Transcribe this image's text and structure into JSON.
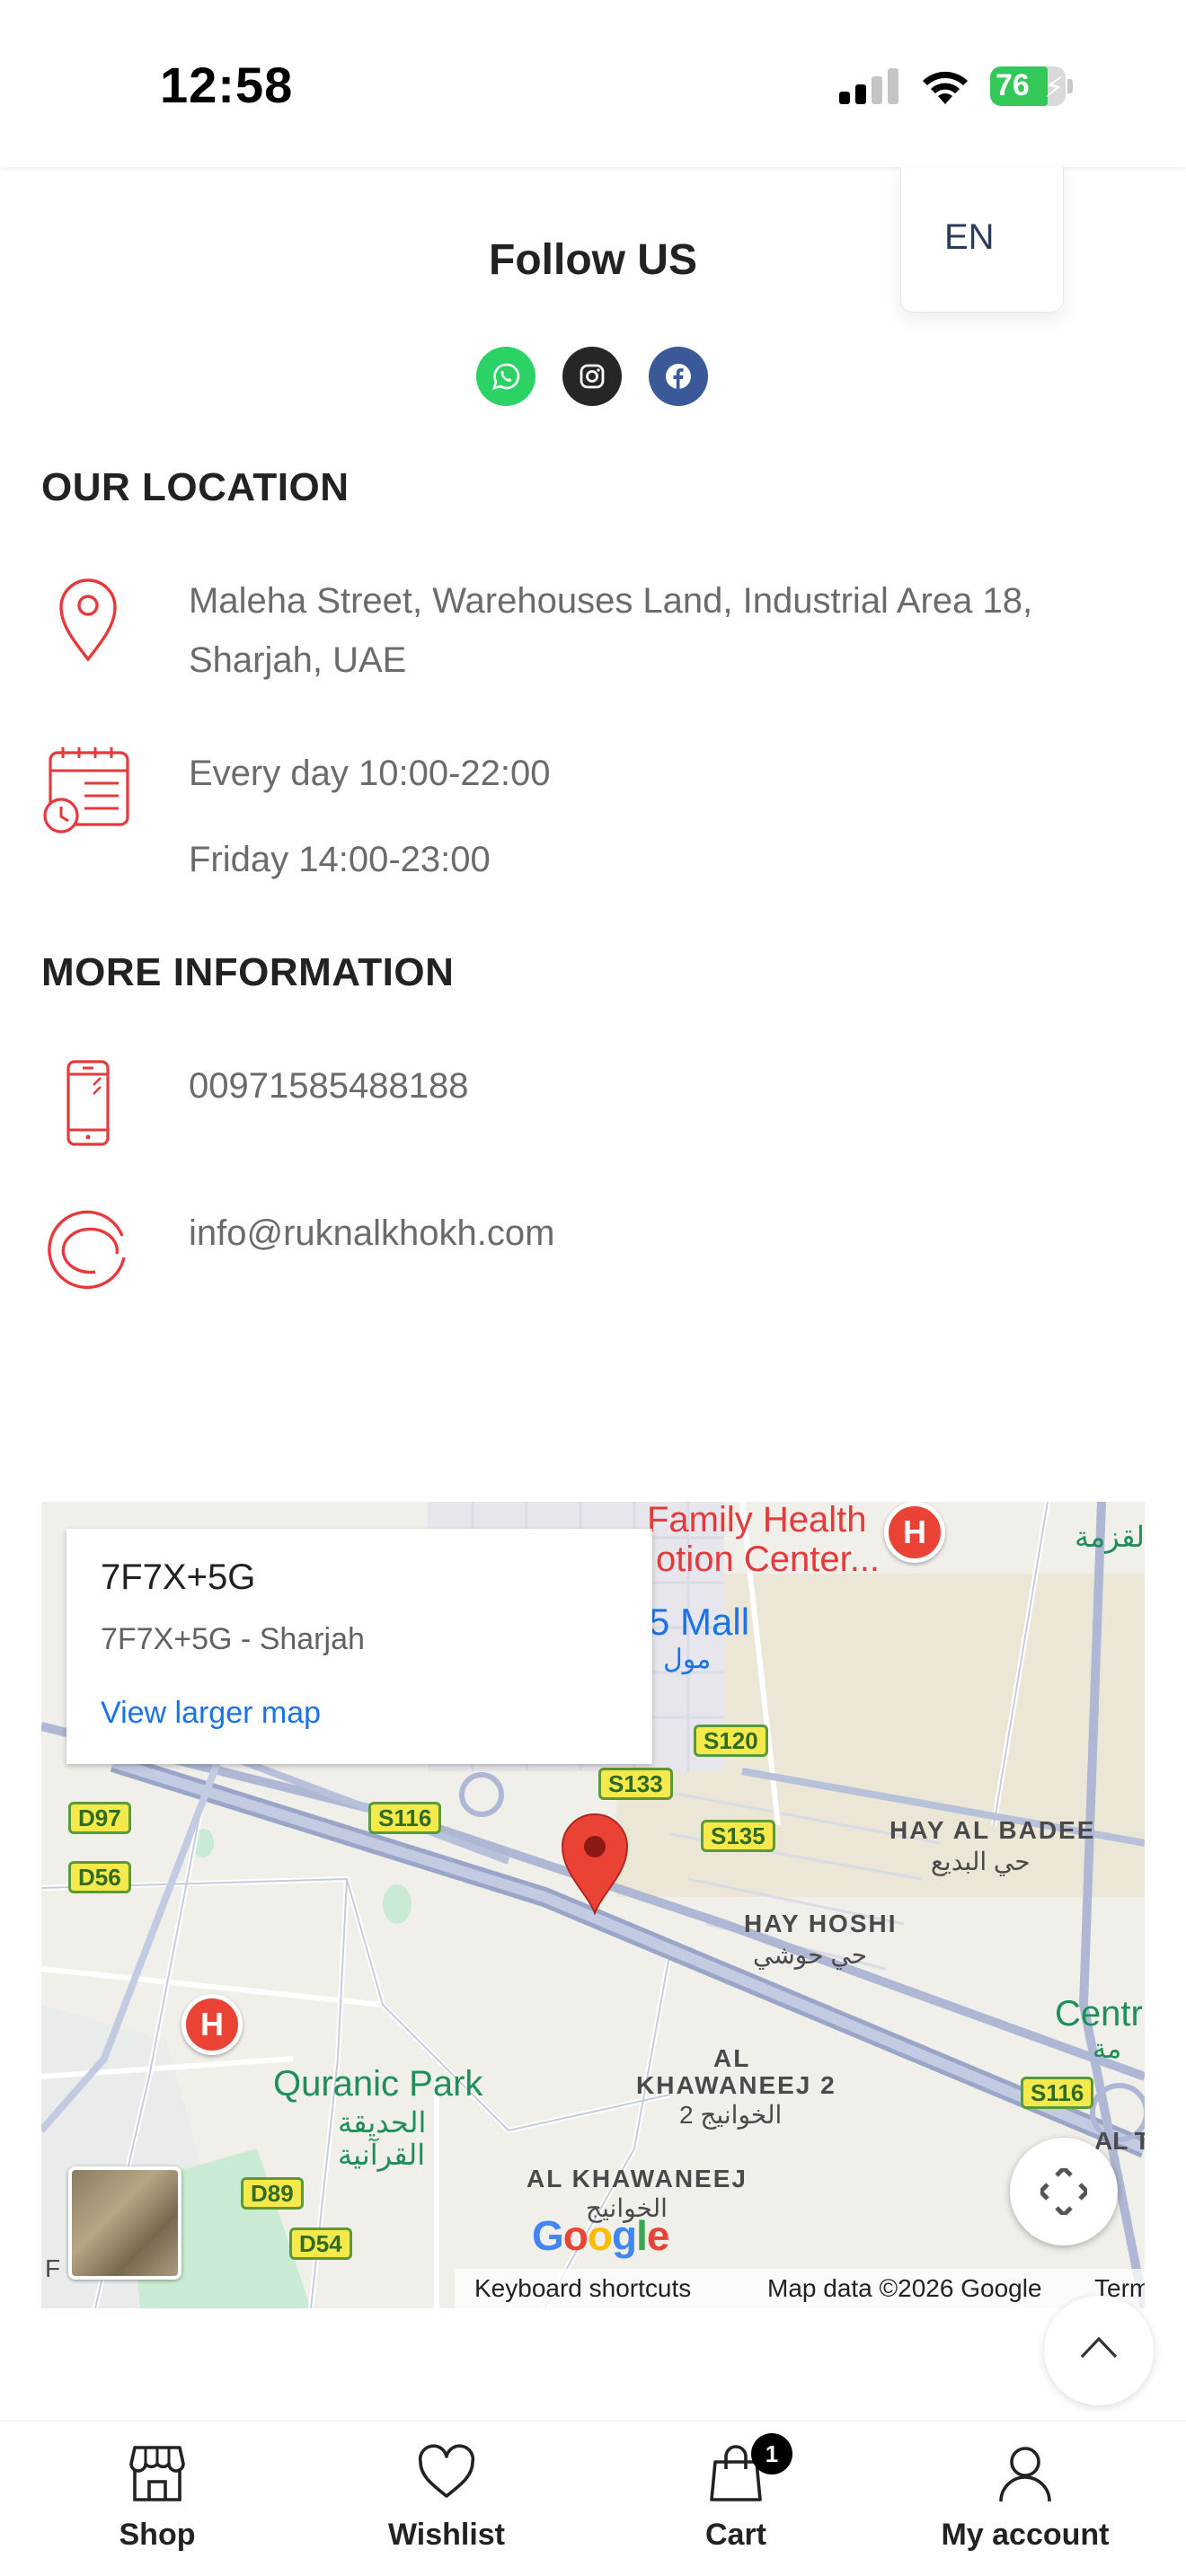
{
  "status_bar": {
    "time": "12:58",
    "battery": "76",
    "battery_level": 0.76
  },
  "language": {
    "selected": "EN"
  },
  "follow": {
    "title": "Follow US",
    "icons": [
      "whatsapp-icon",
      "instagram-icon",
      "facebook-icon"
    ],
    "colors": {
      "whatsapp": "#2bd366",
      "instagram": "#262626",
      "facebook": "#3b5998"
    }
  },
  "location": {
    "title": "OUR LOCATION",
    "address_line1": "Maleha Street, Warehouses Land, Industrial Area 18,",
    "address_line2": "Sharjah, UAE",
    "hours_1": "Every day 10:00-22:00",
    "hours_2": "Friday 14:00-23:00"
  },
  "more_info": {
    "title": "MORE INFORMATION",
    "phone": "00971585488188",
    "email": "info@ruknalkhokh.com"
  },
  "accent_color": "#e5393b",
  "map": {
    "card_title": "7F7X+5G",
    "card_subtitle": "7F7X+5G - Sharjah",
    "card_link": "View larger map",
    "labels": {
      "family_health_1": "Family Health",
      "family_health_2": "otion Center...",
      "mall": "5 Mall",
      "mall_ar": "مول",
      "alqazma": "القزمة",
      "hay_al_badee": "HAY AL BADEE",
      "hay_al_badee_ar": "حي البديع",
      "hay_hoshi": "HAY HOSHI",
      "hay_hoshi_ar": "حي حوشي",
      "centr": "Centr",
      "centr_ar": "مة",
      "quranic_park": "Quranic Park",
      "quranic_park_ar1": "الحديقة",
      "quranic_park_ar2": "القرآنية",
      "al_khawaneej_2_a": "AL",
      "al_khawaneej_2_b": "KHAWANEEJ 2",
      "al_khawaneej_2_ar": "الخوانيج 2",
      "al_khawaneej": "AL KHAWANEEJ",
      "al_khawaneej_ar": "الخوانيج",
      "al_t": "AL T",
      "edge_f": "F"
    },
    "shields": [
      "S120",
      "S133",
      "S135",
      "S116",
      "D97",
      "D56",
      "S116",
      "D89",
      "D54"
    ],
    "google": "Google",
    "footer": {
      "shortcuts": "Keyboard shortcuts",
      "map_data": "Map data ©2026 Google",
      "terms": "Terms"
    }
  },
  "bottom_nav": {
    "items": [
      {
        "label": "Shop",
        "icon": "shop-icon"
      },
      {
        "label": "Wishlist",
        "icon": "heart-icon"
      },
      {
        "label": "Cart",
        "icon": "cart-icon",
        "badge": "1"
      },
      {
        "label": "My account",
        "icon": "user-icon"
      }
    ]
  }
}
